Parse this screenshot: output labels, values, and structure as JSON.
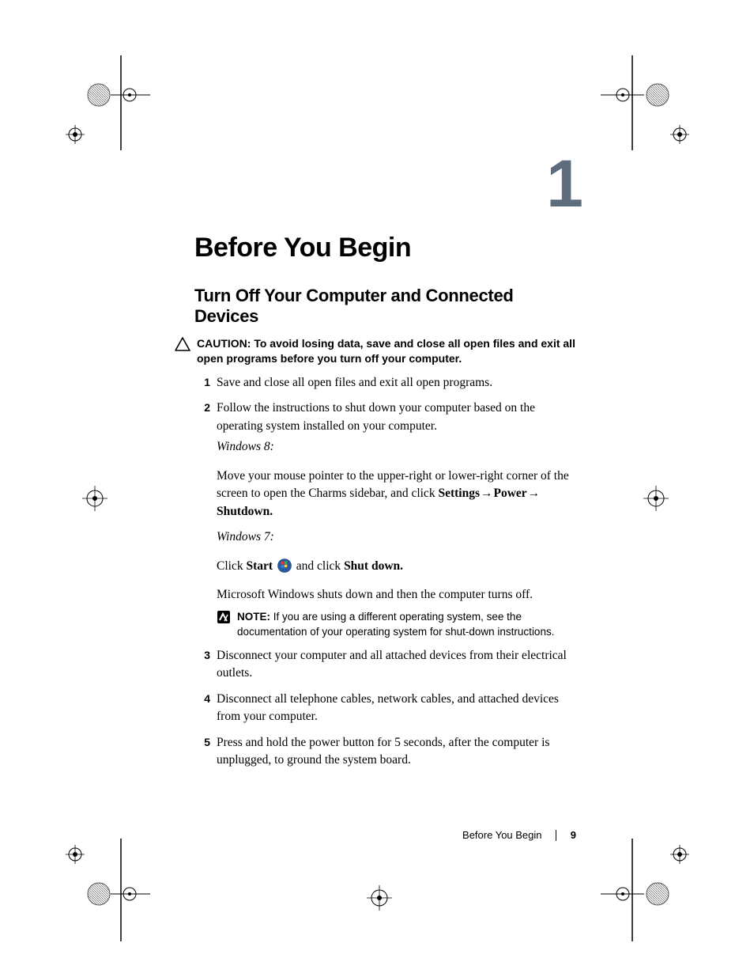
{
  "chapter_number": "1",
  "chapter_title": "Before You Begin",
  "section_title": "Turn Off Your Computer and Connected Devices",
  "caution": {
    "label": "CAUTION:",
    "text": "To avoid losing data, save and close all open files and exit all open programs before you turn off your computer."
  },
  "steps": {
    "s1": "Save and close all open files and exit all open programs.",
    "s2": {
      "lead": "Follow the instructions to shut down your computer based on the operating system installed on your computer.",
      "win8_label": "Windows 8:",
      "win8_text_a": "Move your mouse pointer to the upper-right or lower-right corner of the screen to open the Charms sidebar, and click ",
      "settings": "Settings",
      "power": "Power",
      "shutdown": "Shutdown.",
      "win7_label": "Windows 7:",
      "win7_click": "Click ",
      "win7_start": "Start",
      "win7_and": " and click ",
      "win7_shut": "Shut down.",
      "result": "Microsoft Windows shuts down and then the computer turns off."
    },
    "note": {
      "label": "NOTE:",
      "text": "If you are using a different operating system, see the documentation of your operating system for shut-down instructions."
    },
    "s3": "Disconnect your computer and all attached devices from their electrical outlets.",
    "s4": "Disconnect all telephone cables, network cables, and attached devices from your computer.",
    "s5": "Press and hold the power button for 5 seconds, after the computer is unplugged, to ground the system board."
  },
  "footer": {
    "section": "Before You Begin",
    "page": "9"
  }
}
